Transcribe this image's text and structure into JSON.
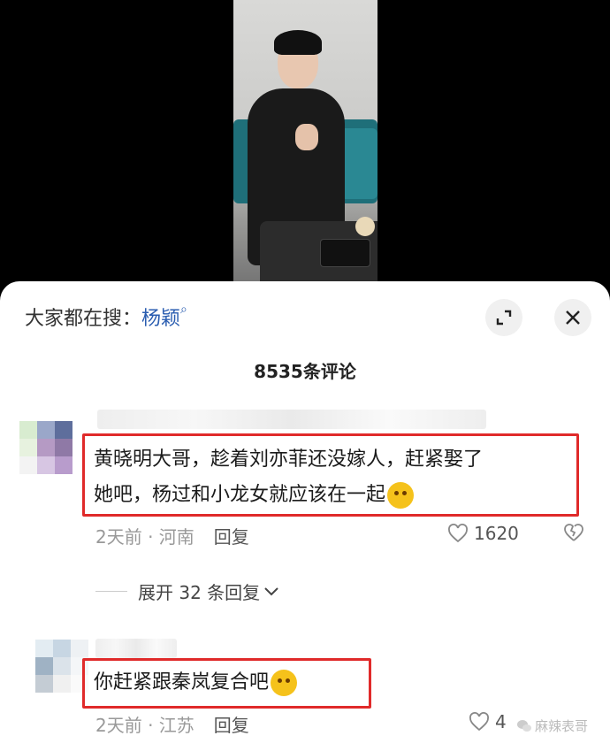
{
  "search_prompt": {
    "label": "大家都在搜：",
    "term": "杨颖"
  },
  "comments_header": {
    "title": "8535条评论"
  },
  "comments": [
    {
      "text_line1": "黄晓明大哥，趁着刘亦菲还没嫁人，赶紧娶了",
      "text_line2": "她吧，杨过和小龙女就应该在一起",
      "meta": "2天前 · 河南",
      "reply_label": "回复",
      "likes": "1620"
    },
    {
      "text_line1": "你赶紧跟秦岚复合吧",
      "meta": "2天前 · 江苏",
      "reply_label": "回复",
      "likes": "4"
    }
  ],
  "expand_replies": {
    "label": "展开 32 条回复"
  },
  "watermark": {
    "text": "麻辣表哥"
  },
  "colors": {
    "highlight_box": "#e02a2a",
    "search_term": "#2a5db0"
  }
}
